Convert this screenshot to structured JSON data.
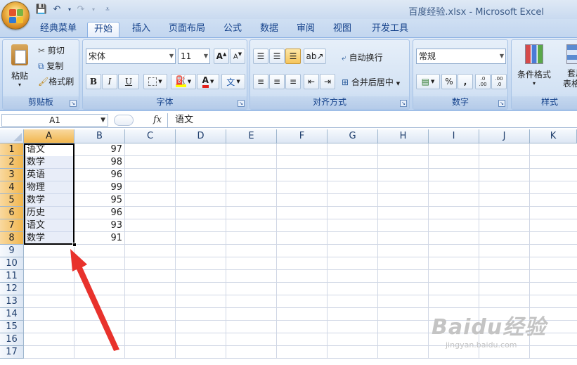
{
  "window": {
    "title": "百度经验.xlsx - Microsoft Excel"
  },
  "tabs": [
    "经典菜单",
    "开始",
    "插入",
    "页面布局",
    "公式",
    "数据",
    "审阅",
    "视图",
    "开发工具"
  ],
  "active_tab": "开始",
  "ribbon": {
    "clipboard": {
      "label": "剪贴板",
      "paste": "粘贴",
      "cut": "剪切",
      "copy": "复制",
      "format_painter": "格式刷"
    },
    "font": {
      "label": "字体",
      "font_name": "宋体",
      "font_size": "11",
      "bold": "B",
      "italic": "I",
      "underline": "U",
      "font_color_glyph": "A",
      "phonetic_glyph": "文"
    },
    "alignment": {
      "label": "对齐方式",
      "wrap_text": "自动换行",
      "merge_center": "合并后居中"
    },
    "number": {
      "label": "数字",
      "format": "常规",
      "percent": "%",
      "comma": ",",
      "increase_decimal": ".0 .00",
      "decrease_decimal": ".00 .0"
    },
    "styles": {
      "label": "样式",
      "conditional_format": "条件格式",
      "table_format": "套用\n表格格"
    }
  },
  "formula_bar": {
    "name_box": "A1",
    "fx": "fx",
    "content": "语文"
  },
  "columns": [
    "A",
    "B",
    "C",
    "D",
    "E",
    "F",
    "G",
    "H",
    "I",
    "J",
    "K"
  ],
  "rows": [
    "1",
    "2",
    "3",
    "4",
    "5",
    "6",
    "7",
    "8",
    "9",
    "10",
    "11",
    "12",
    "13",
    "14",
    "15",
    "16",
    "17"
  ],
  "cells": {
    "A": [
      "语文",
      "数学",
      "英语",
      "物理",
      "数学",
      "历史",
      "语文",
      "数学"
    ],
    "B": [
      "97",
      "98",
      "96",
      "99",
      "95",
      "96",
      "93",
      "91"
    ]
  },
  "watermark": {
    "brand": "Baidu经验",
    "url": "jingyan.baidu.com"
  },
  "colors": {
    "selection_header": "#f1b64e",
    "annotation_arrow": "#e8322c",
    "ribbon_text": "#15428b"
  }
}
